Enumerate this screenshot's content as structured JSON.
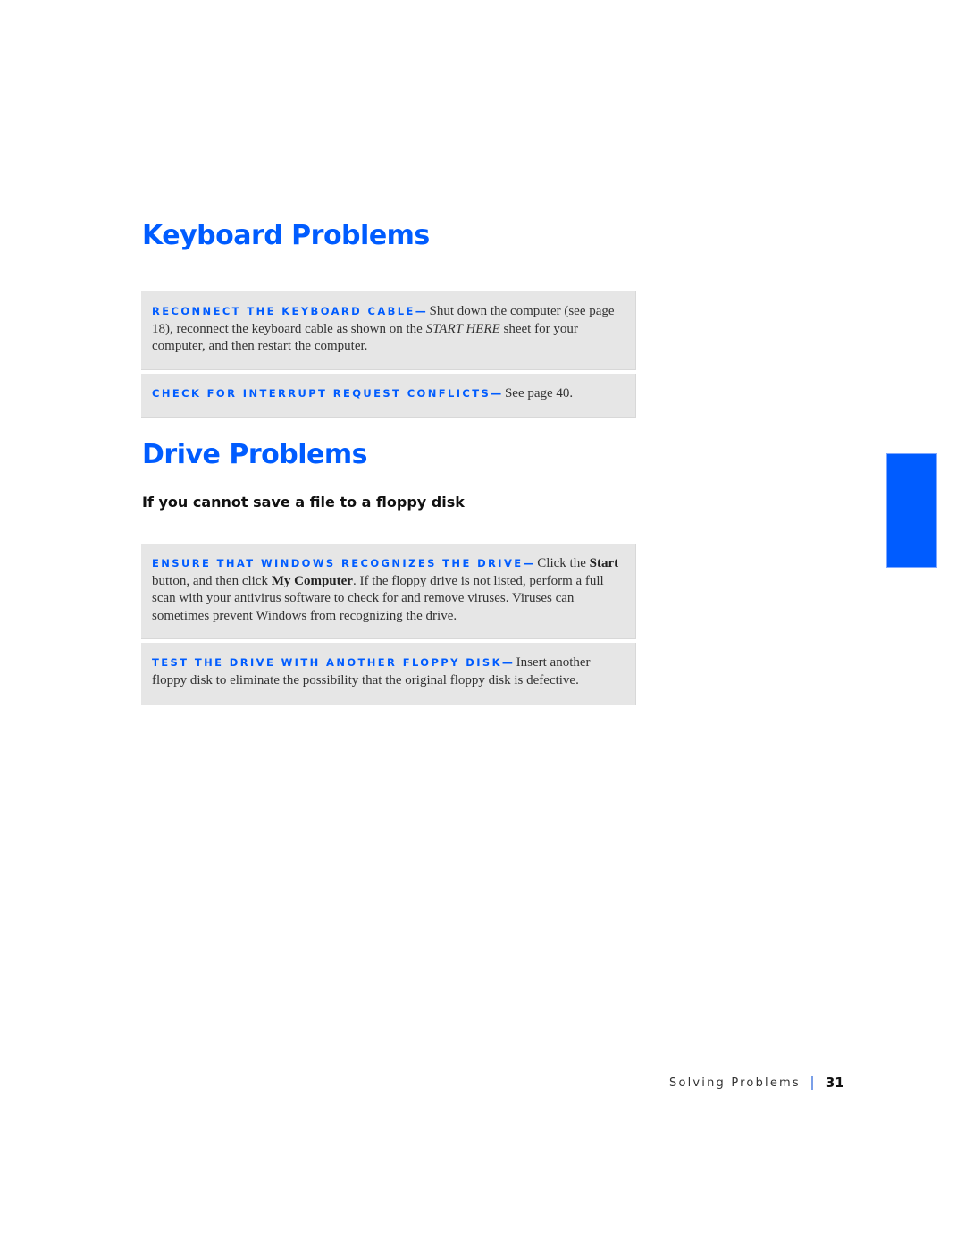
{
  "sections": [
    {
      "title": "Keyboard Problems",
      "items": [
        {
          "lead": "Reconnect the keyboard cable",
          "dash": "—",
          "body_before": " Shut down the computer (see page 18), reconnect the keyboard cable as shown on the ",
          "emphasis": "START HERE",
          "body_after": " sheet for your computer, and then restart the computer."
        },
        {
          "lead": "Check for interrupt request conflicts",
          "dash": "—",
          "body": " See page 40."
        }
      ]
    },
    {
      "title": "Drive Problems",
      "subtitle": "If you cannot save a file to a floppy disk",
      "items": [
        {
          "lead": "Ensure that Windows recognizes the drive",
          "dash": "—",
          "body_1": " Click the ",
          "bold_1": "Start",
          "body_2": " button, and then click ",
          "bold_2": "My Computer",
          "body_3": ". If the floppy drive is not listed, perform a full scan with your antivirus software to check for and remove viruses. Viruses can sometimes prevent Windows from recognizing the drive."
        },
        {
          "lead": "Test the drive with another floppy disk",
          "dash": "—",
          "body": " Insert another floppy disk to eliminate the possibility that the original floppy disk is defective."
        }
      ]
    }
  ],
  "footer": {
    "section_name": "Solving Problems",
    "page_number": "31"
  },
  "colors": {
    "accent": "#005cff",
    "box_background": "#e6e6e6"
  }
}
